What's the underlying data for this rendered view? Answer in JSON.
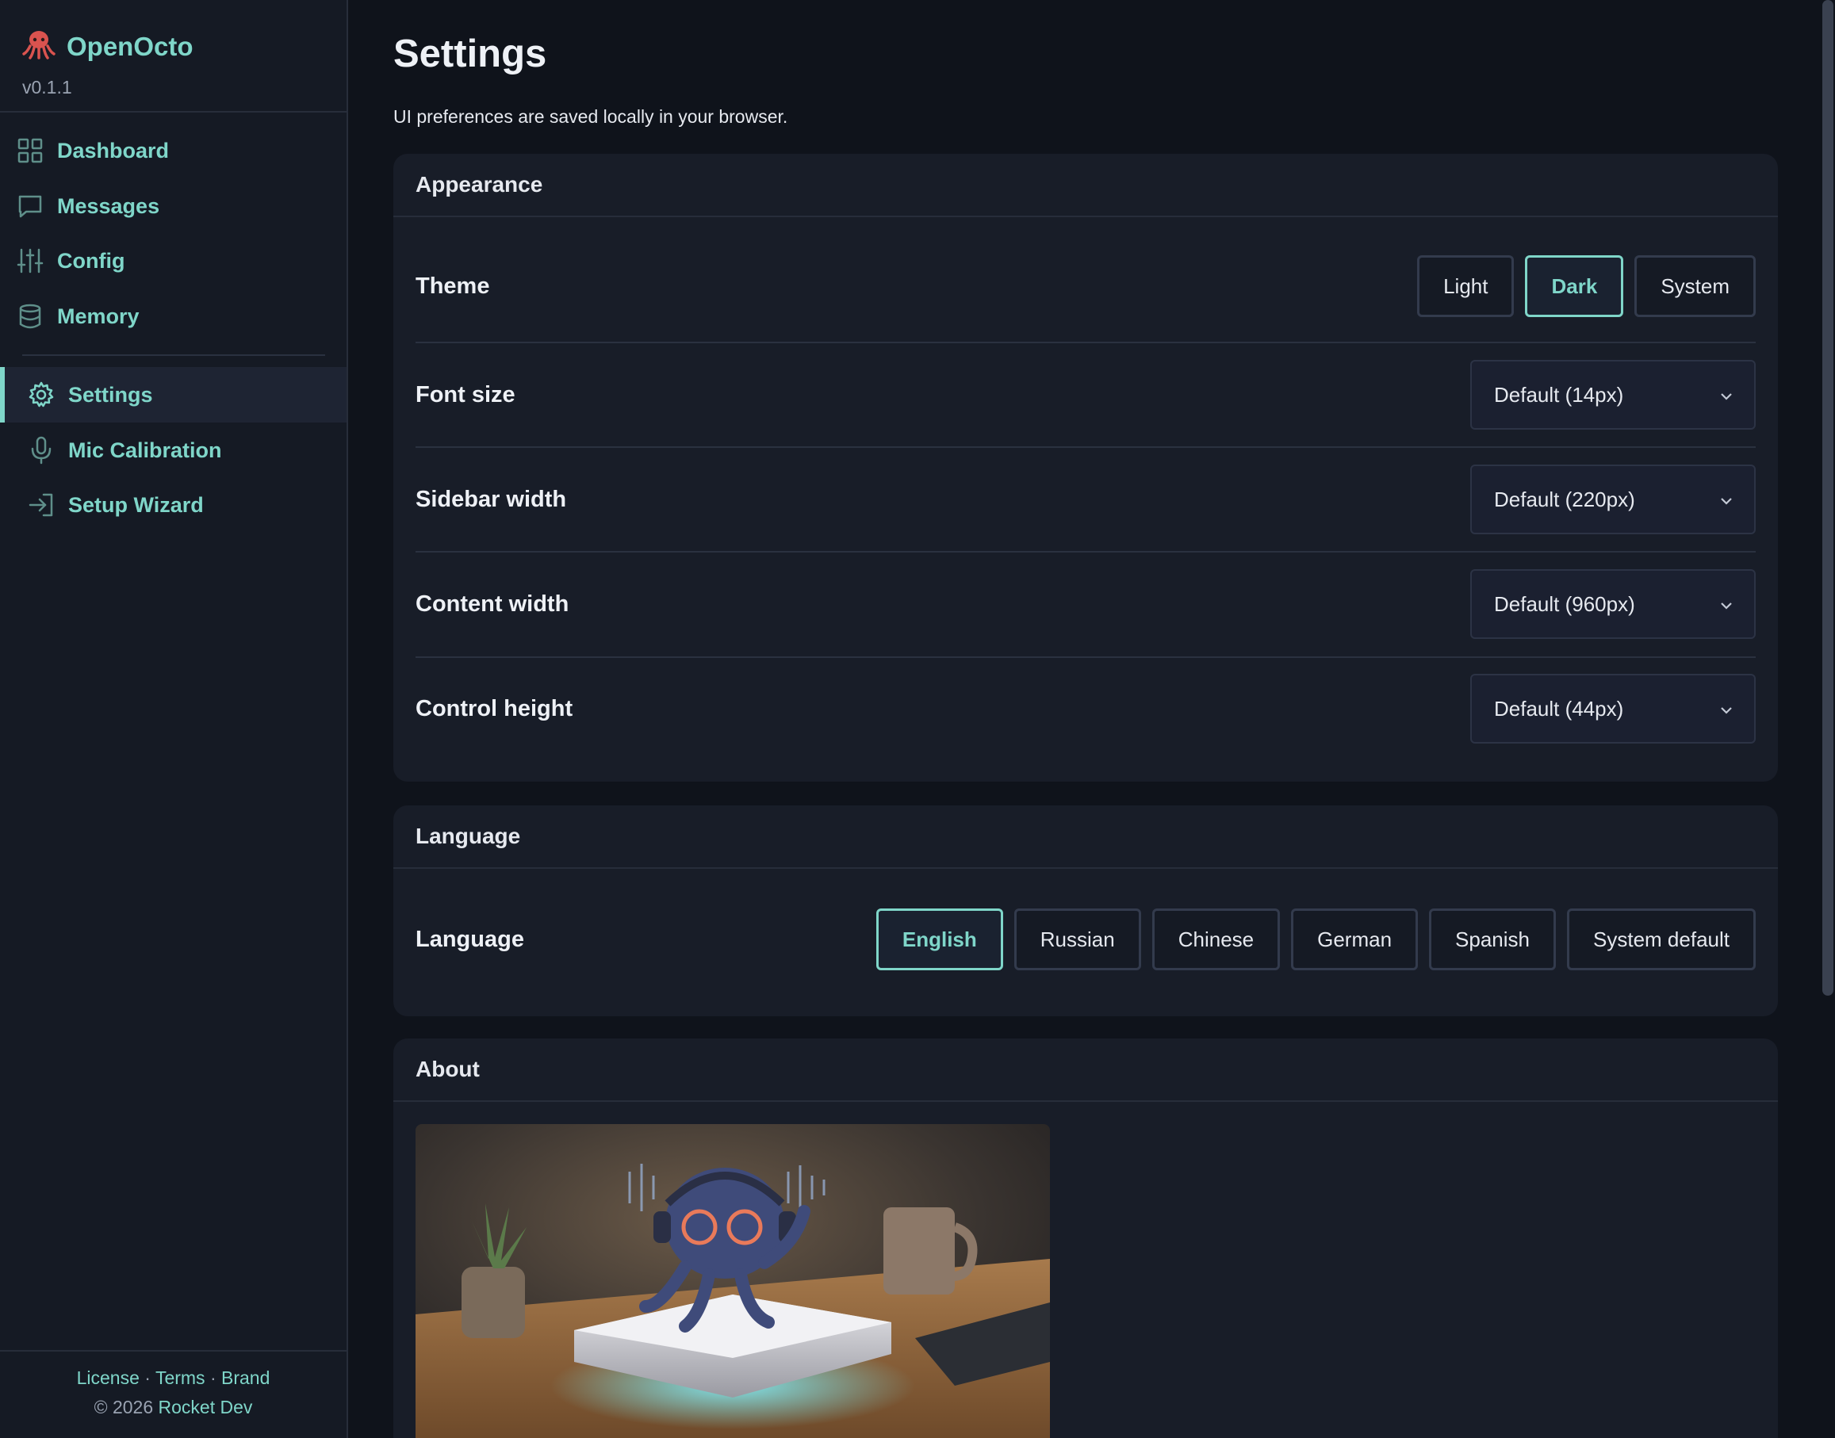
{
  "app": {
    "name": "OpenOcto",
    "version": "v0.1.1",
    "logo_icon": "octopus-icon"
  },
  "sidebar": {
    "primary": [
      {
        "label": "Dashboard",
        "icon": "grid-icon"
      },
      {
        "label": "Messages",
        "icon": "chat-bubble-icon"
      },
      {
        "label": "Config",
        "icon": "sliders-icon"
      },
      {
        "label": "Memory",
        "icon": "database-icon"
      }
    ],
    "secondary": [
      {
        "label": "Settings",
        "icon": "gear-icon",
        "active": true
      },
      {
        "label": "Mic Calibration",
        "icon": "microphone-icon"
      },
      {
        "label": "Setup Wizard",
        "icon": "sign-in-arrow-icon"
      }
    ],
    "footer": {
      "links": [
        "License",
        "Terms",
        "Brand"
      ],
      "separator": "·",
      "copyright": "© 2026",
      "org": "Rocket Dev"
    }
  },
  "page": {
    "title": "Settings",
    "subtitle": "UI preferences are saved locally in your browser."
  },
  "appearance": {
    "header": "Appearance",
    "theme": {
      "label": "Theme",
      "options": [
        "Light",
        "Dark",
        "System"
      ],
      "selected": "Dark"
    },
    "font_size": {
      "label": "Font size",
      "value": "Default (14px)"
    },
    "sidebar_width": {
      "label": "Sidebar width",
      "value": "Default (220px)"
    },
    "content_width": {
      "label": "Content width",
      "value": "Default (960px)"
    },
    "control_height": {
      "label": "Control height",
      "value": "Default (44px)"
    }
  },
  "language": {
    "header": "Language",
    "label": "Language",
    "options": [
      "English",
      "Russian",
      "Chinese",
      "German",
      "Spanish",
      "System default"
    ],
    "selected": "English"
  },
  "about": {
    "header": "About"
  },
  "colors": {
    "accent": "#7fd6c9",
    "background": "#0f131b",
    "sidebar": "#151a24",
    "card": "#181d28"
  }
}
